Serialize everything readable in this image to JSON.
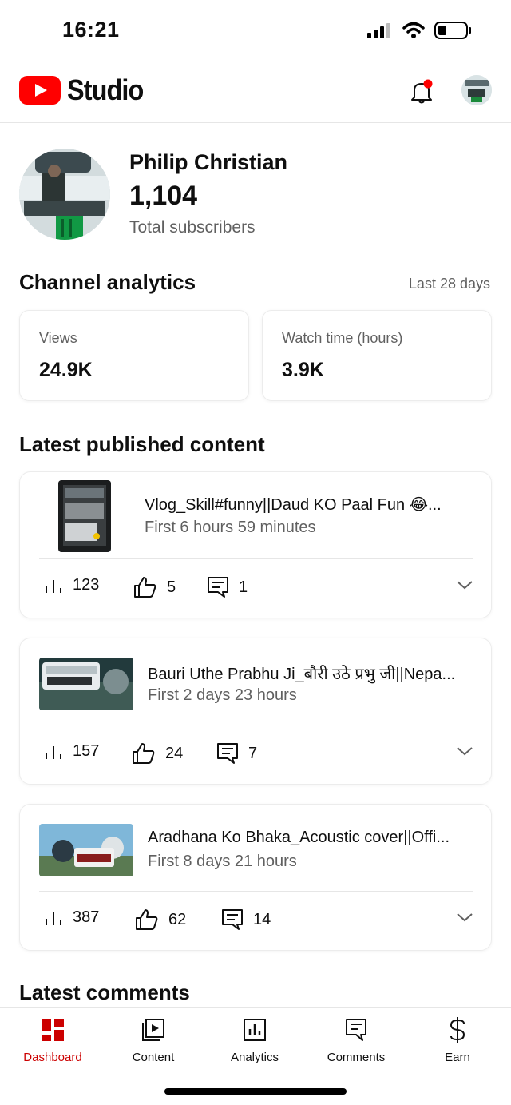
{
  "status_bar": {
    "time": "16:21"
  },
  "header": {
    "logo_text": "Studio",
    "notification_badge_color": "#ff0000"
  },
  "channel": {
    "name": "Philip Christian",
    "subscribers": "1,104",
    "subscribers_label": "Total subscribers"
  },
  "analytics": {
    "title": "Channel analytics",
    "period": "Last 28 days",
    "metrics": [
      {
        "label": "Views",
        "value": "24.9K"
      },
      {
        "label": "Watch time (hours)",
        "value": "3.9K"
      }
    ]
  },
  "latest_content": {
    "title": "Latest published content",
    "videos": [
      {
        "title": "Vlog_Skill#funny||Daud KO Paal Fun 😂...",
        "period": "First 6 hours 59 minutes",
        "views": "123",
        "likes": "5",
        "comments": "1"
      },
      {
        "title": "Bauri Uthe Prabhu Ji_बौरी उठे प्रभु जी||Nepa...",
        "period": "First 2 days 23 hours",
        "views": "157",
        "likes": "24",
        "comments": "7"
      },
      {
        "title": "Aradhana Ko Bhaka_Acoustic cover||Offi...",
        "period": "First 8 days 21 hours",
        "views": "387",
        "likes": "62",
        "comments": "14"
      }
    ]
  },
  "latest_comments": {
    "title": "Latest comments"
  },
  "bottom_nav": {
    "items": [
      {
        "label": "Dashboard",
        "icon": "dashboard-icon",
        "active": true
      },
      {
        "label": "Content",
        "icon": "content-icon"
      },
      {
        "label": "Analytics",
        "icon": "analytics-icon"
      },
      {
        "label": "Comments",
        "icon": "comments-icon"
      },
      {
        "label": "Earn",
        "icon": "dollar-icon"
      }
    ]
  },
  "colors": {
    "accent": "#cc0000",
    "brand_red": "#ff0000",
    "secondary_text": "#606060"
  }
}
